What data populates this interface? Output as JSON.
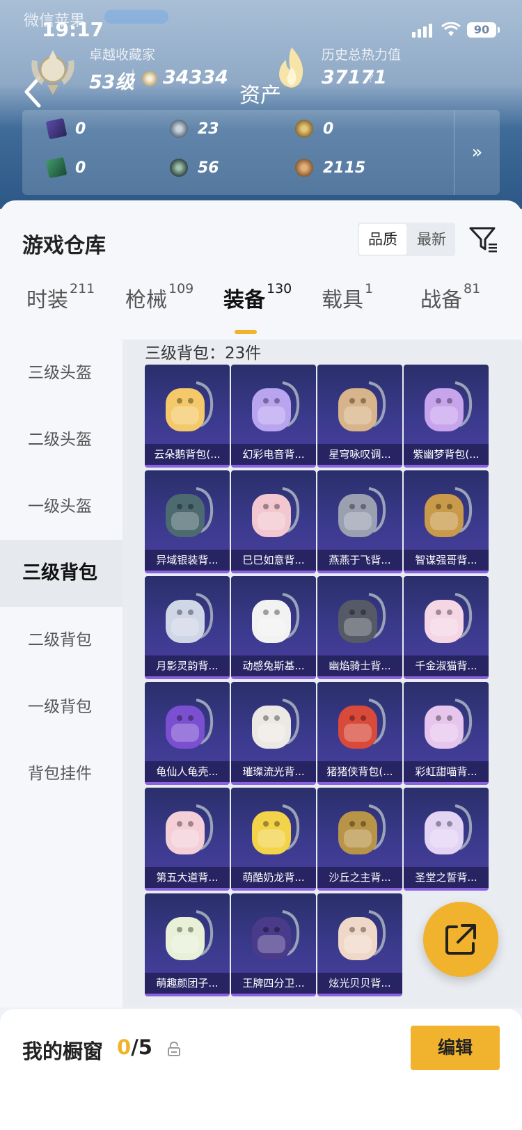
{
  "status_bar": {
    "carrier": "微信苹果",
    "time": "19:17",
    "battery": "90"
  },
  "header": {
    "page_title": "资产",
    "profile_title": "卓越收藏家",
    "level": "53级",
    "score": "34334",
    "heat_title": "历史总热力值",
    "heat_value": "37171",
    "help_mark": "?",
    "assets": [
      {
        "icon": "purple-card-icon",
        "value": "0"
      },
      {
        "icon": "silver-coin-icon",
        "value": "23"
      },
      {
        "icon": "gold-coin-icon",
        "value": "0"
      },
      {
        "icon": "green-card-icon",
        "value": "0"
      },
      {
        "icon": "dark-coin-icon",
        "value": "56"
      },
      {
        "icon": "bronze-coin-icon",
        "value": "2115"
      }
    ],
    "assets_more": "»"
  },
  "warehouse": {
    "title": "游戏仓库",
    "sort_options": [
      "品质",
      "最新"
    ],
    "sort_selected": "品质"
  },
  "tabs": [
    {
      "label": "时装",
      "count": "211"
    },
    {
      "label": "枪械",
      "count": "109"
    },
    {
      "label": "装备",
      "count": "130",
      "active": true
    },
    {
      "label": "载具",
      "count": "1"
    },
    {
      "label": "战备",
      "count": "81"
    }
  ],
  "sidebar": [
    {
      "label": "三级头盔"
    },
    {
      "label": "二级头盔"
    },
    {
      "label": "一级头盔"
    },
    {
      "label": "三级背包",
      "active": true
    },
    {
      "label": "二级背包"
    },
    {
      "label": "一级背包"
    },
    {
      "label": "背包挂件"
    }
  ],
  "section_title": "三级背包：23件",
  "items": [
    "云朵鹅背包(...",
    "幻彩电音背...",
    "星穹咏叹调...",
    "紫幽梦背包(...",
    "异域银装背...",
    "巳巳如意背...",
    "燕燕于飞背...",
    "智谋强哥背...",
    "月影灵韵背...",
    "动感兔斯基...",
    "幽焰骑士背...",
    "千金淑猫背...",
    "龟仙人龟壳...",
    "璀璨流光背...",
    "猪猪侠背包(...",
    "彩虹甜喵背...",
    "第五大道背...",
    "萌酷奶龙背...",
    "沙丘之主背...",
    "圣堂之誓背...",
    "萌趣颜团子...",
    "王牌四分卫...",
    "炫光贝贝背..."
  ],
  "item_colors": [
    "#f4c96a",
    "#b9a4f0",
    "#d8b48a",
    "#c7a4ec",
    "#4c6a70",
    "#f2c7cf",
    "#9aa0b0",
    "#c89a4a",
    "#cfd6e6",
    "#f2f2f2",
    "#555a66",
    "#f4d6e4",
    "#7a4fd0",
    "#ece8e4",
    "#d94a3a",
    "#e7c6ee",
    "#f4cfd8",
    "#f2d34a",
    "#b89448",
    "#e4d4f4",
    "#e8f0d8",
    "#4a3a8a",
    "#f0d8c8"
  ],
  "bottom_bar": {
    "shelf_label": "我的橱窗",
    "shelf_used": "0",
    "shelf_total": "/5",
    "edit_label": "编辑"
  },
  "colors": {
    "accent": "#f1b32e",
    "card_bg": "#3b3a8e",
    "card_border": "#8a62e0"
  }
}
